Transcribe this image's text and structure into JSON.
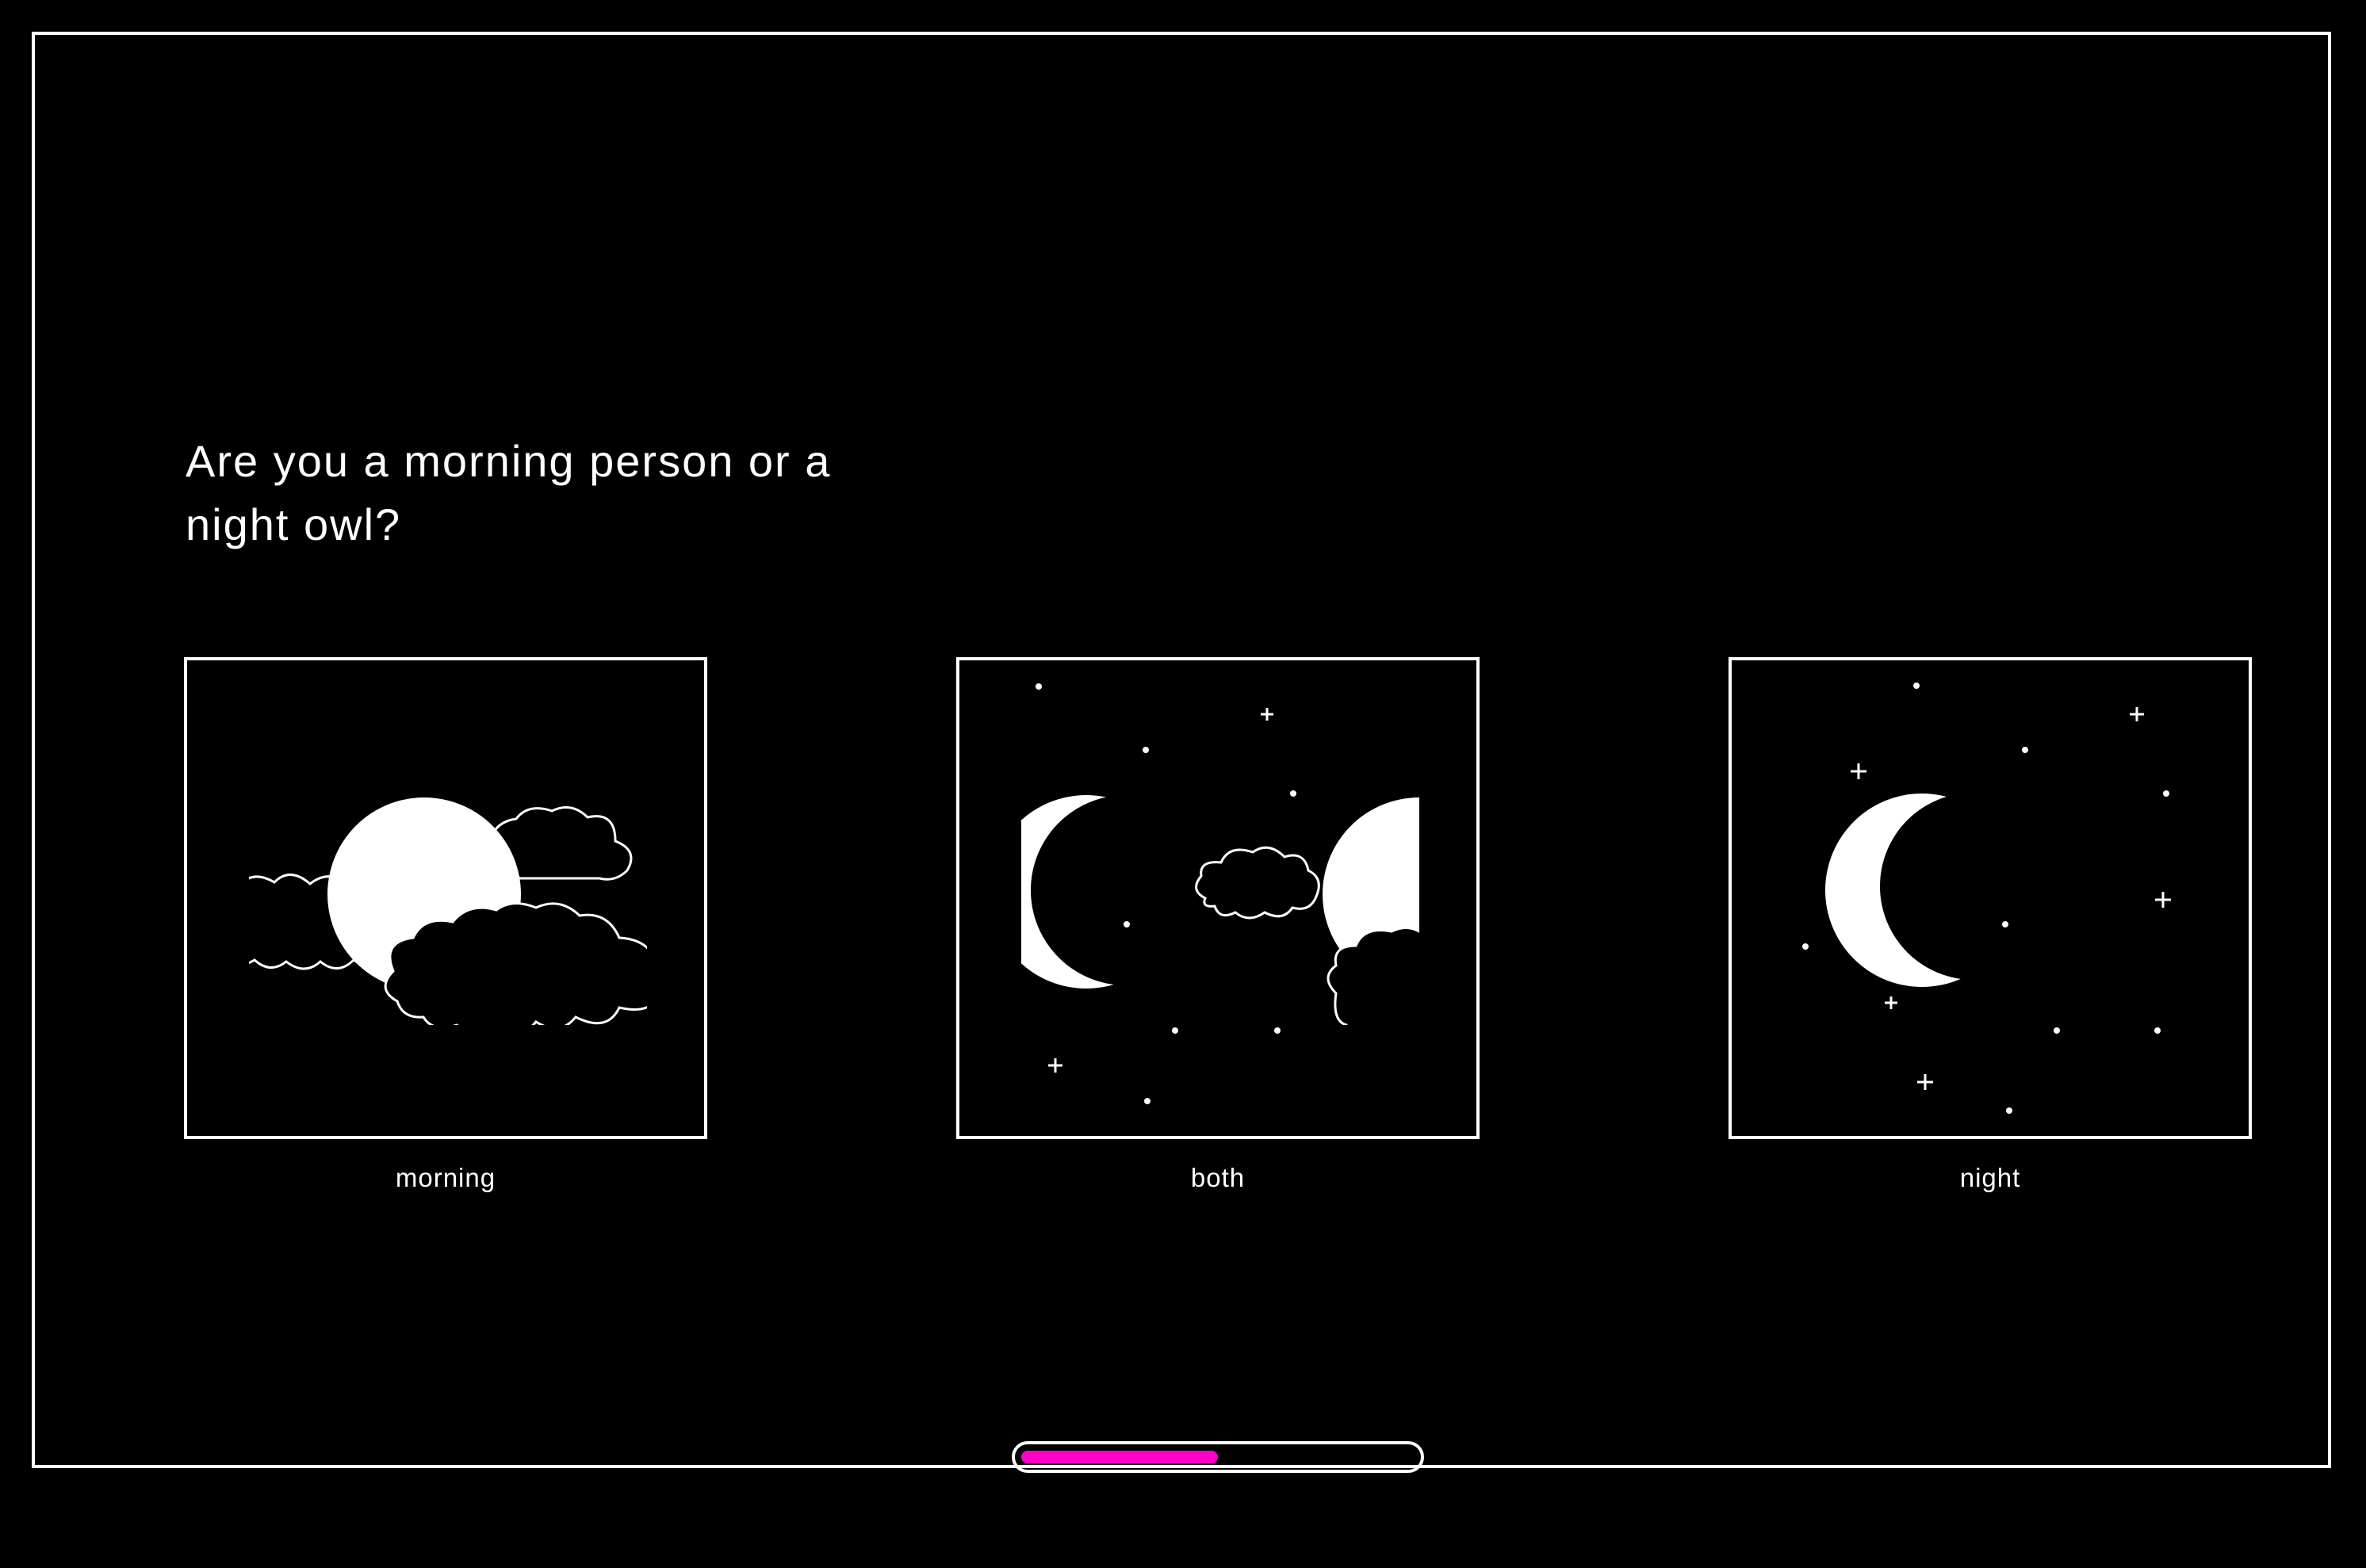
{
  "question": "Are you a morning person or a night owl?",
  "options": [
    {
      "id": "morning",
      "label": "morning",
      "icon": "sun-with-clouds-icon"
    },
    {
      "id": "both",
      "label": "both",
      "icon": "moon-and-sun-icon"
    },
    {
      "id": "night",
      "label": "night",
      "icon": "crescent-moon-stars-icon"
    }
  ],
  "progress": {
    "value": 0.5
  },
  "colors": {
    "accent": "#ff00c8",
    "background": "#000000",
    "foreground": "#ffffff"
  }
}
